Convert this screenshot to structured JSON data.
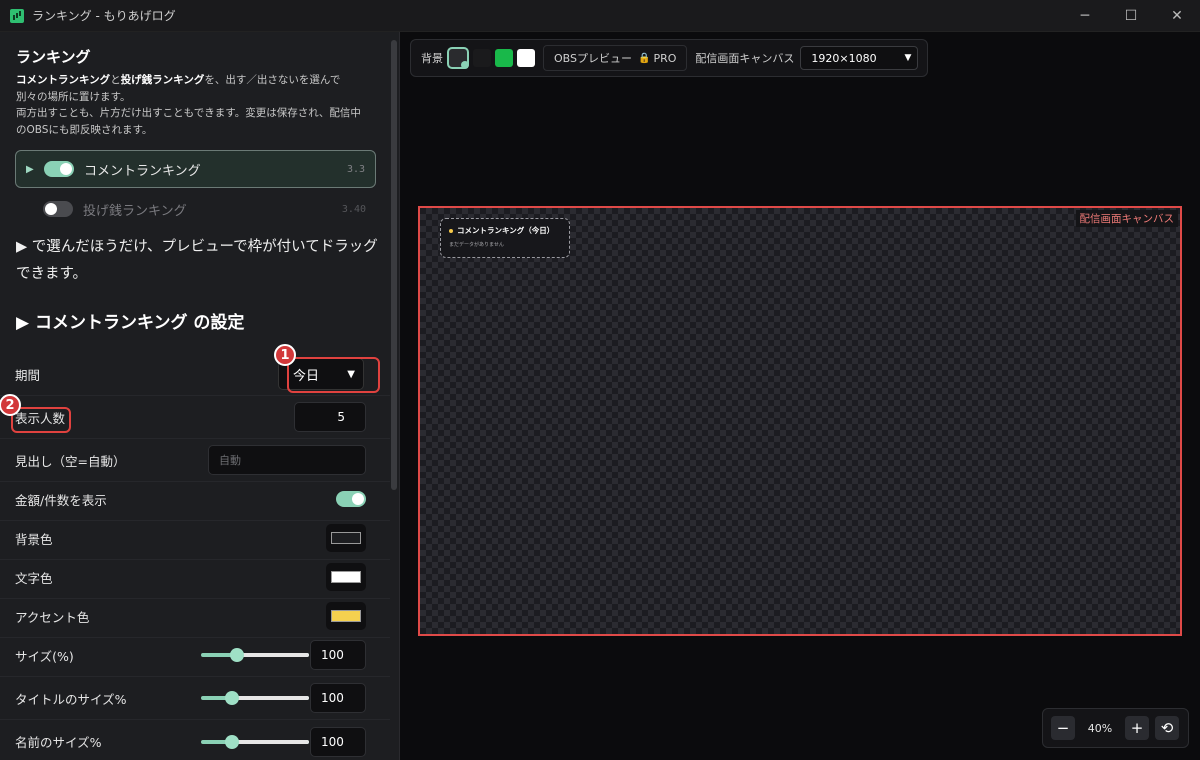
{
  "window": {
    "title": "ランキング - もりあげログ"
  },
  "left": {
    "title": "ランキング",
    "desc_line1_a": "コメントランキング",
    "desc_line1_b": "と",
    "desc_line1_c": "投げ銭ランキング",
    "desc_line1_d": "を、出す／出さないを選んで",
    "desc_line2": "別々の場所に置けます。",
    "desc_line3": "両方出すことも、片方だけ出すこともできます。変更は保存され、配信中",
    "desc_line4": "のOBSにも即反映されます。",
    "rankings": [
      {
        "label": "コメントランキング",
        "version": "3.3",
        "enabled": true
      },
      {
        "label": "投げ銭ランキング",
        "version": "3.40",
        "enabled": false
      }
    ],
    "hint": "▶ で選んだほうだけ、プレビューで枠が付いてドラッグできます。",
    "section_title": "▶ コメントランキング の設定",
    "settings": {
      "period_label": "期間",
      "period_value": "今日",
      "count_label": "表示人数",
      "count_value": "5",
      "heading_label": "見出し（空=自動）",
      "heading_placeholder": "自動",
      "show_amount_label": "金額/件数を表示",
      "bg_color_label": "背景色",
      "text_color_label": "文字色",
      "accent_color_label": "アクセント色",
      "size_label": "サイズ(%)",
      "size_value": "100",
      "title_size_label": "タイトルのサイズ%",
      "title_size_value": "100",
      "name_size_label": "名前のサイズ%",
      "name_size_value": "100"
    },
    "colors": {
      "bg": "#1d1e21",
      "text": "#ffffff",
      "accent": "#f5d14f"
    },
    "sliders": {
      "size": 0.33,
      "title_size": 0.29,
      "name_size": 0.29
    },
    "badges": [
      "1",
      "2"
    ]
  },
  "toolbar": {
    "bg_label": "背景",
    "bg_options": [
      "checker",
      "#1a1a1c",
      "#19b84a",
      "#ffffff"
    ],
    "obs_label": "OBSプレビュー",
    "pro_label": "PRO",
    "canvas_label": "配信画面キャンバス",
    "resolution": "1920×1080"
  },
  "canvas": {
    "label": "配信画面キャンバス",
    "widget_title": "コメントランキング（今日）",
    "widget_empty": "まだデータがありません"
  },
  "zoom": {
    "minus": "−",
    "value": "40%",
    "plus": "+",
    "reset": "⟲"
  }
}
